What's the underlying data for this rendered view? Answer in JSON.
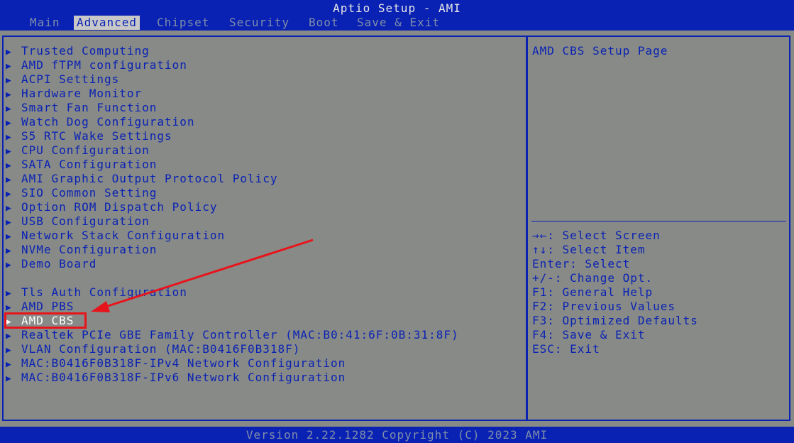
{
  "title": "Aptio Setup - AMI",
  "tabs": [
    "Main",
    "Advanced",
    "Chipset",
    "Security",
    "Boot",
    "Save & Exit"
  ],
  "active_tab": "Advanced",
  "menu_items": [
    "Trusted Computing",
    "AMD fTPM configuration",
    "ACPI Settings",
    "Hardware Monitor",
    "Smart Fan Function",
    "Watch Dog Configuration",
    "S5 RTC Wake Settings",
    "CPU Configuration",
    "SATA Configuration",
    "AMI Graphic Output Protocol Policy",
    "SIO Common Setting",
    "Option ROM Dispatch Policy",
    "USB Configuration",
    "Network Stack Configuration",
    "NVMe Configuration",
    "Demo Board",
    "Tls Auth Configuration",
    "AMD PBS",
    "AMD CBS",
    "Realtek PCIe GBE Family Controller (MAC:B0:41:6F:0B:31:8F)",
    "VLAN Configuration (MAC:B0416F0B318F)",
    "MAC:B0416F0B318F-IPv4 Network Configuration",
    "MAC:B0416F0B318F-IPv6 Network Configuration"
  ],
  "selected_item": "AMD CBS",
  "item_help": "AMD CBS Setup Page",
  "key_help": [
    "→←: Select Screen",
    "↑↓: Select Item",
    "Enter: Select",
    "+/-: Change Opt.",
    "F1: General Help",
    "F2: Previous Values",
    "F3: Optimized Defaults",
    "F4: Save & Exit",
    "ESC: Exit"
  ],
  "version": "Version 2.22.1282 Copyright (C) 2023 AMI",
  "colors": {
    "bar_blue": "#0a22b4",
    "panel_gray": "#878a87",
    "text_blue": "#0a22b4",
    "selected_white": "#ffffff",
    "annotation_red": "#e8141b"
  }
}
